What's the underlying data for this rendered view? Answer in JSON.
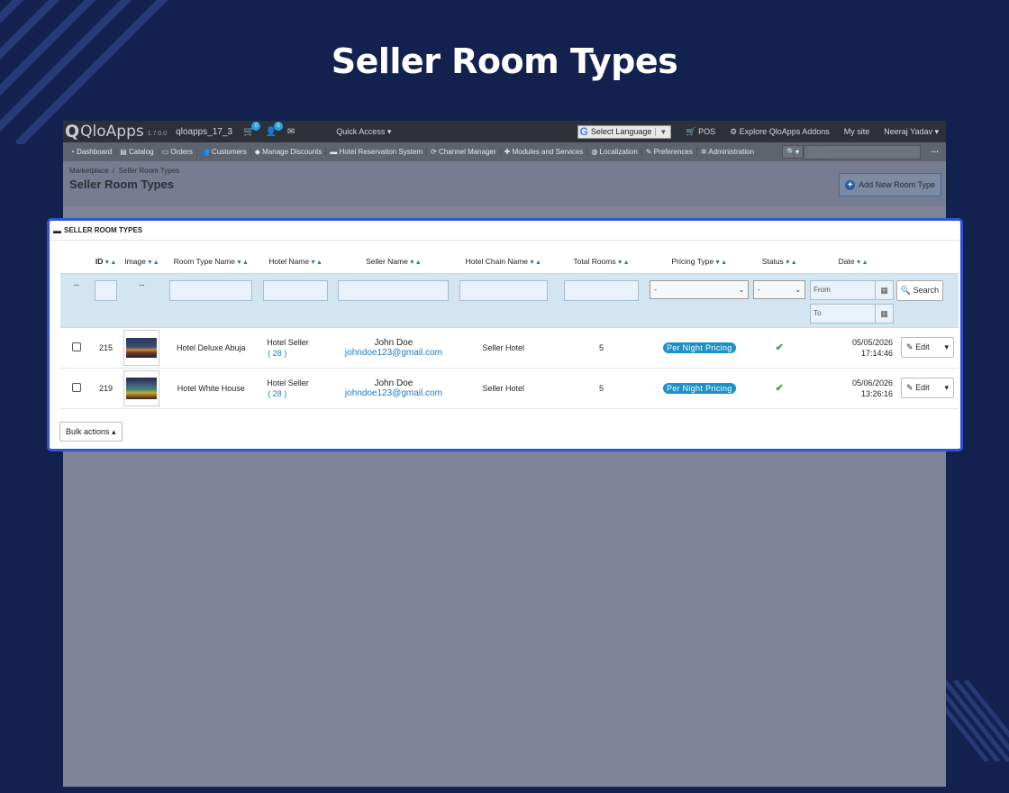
{
  "hero": {
    "title": "Seller Room Types"
  },
  "topbar": {
    "logo": "QloApps",
    "version": "1.7.0.0",
    "shop": "qloapps_17_3",
    "cart_badge": "0",
    "user_badge": "0",
    "quick_access": "Quick Access",
    "language": "Select Language",
    "pos": "POS",
    "explore": "Explore QloApps Addons",
    "mysite": "My site",
    "user": "Neeraj Yadav"
  },
  "menu": {
    "items": [
      "Dashboard",
      "Catalog",
      "Orders",
      "Customers",
      "Manage Discounts",
      "Hotel Reservation System",
      "Channel Manager",
      "Modules and Services",
      "Localization",
      "Preferences",
      "Administration"
    ],
    "search_placeholder": "Search"
  },
  "page": {
    "breadcrumb": [
      "Marketplace",
      "Seller Room Types"
    ],
    "title": "Seller Room Types",
    "add_button": "Add New Room Type"
  },
  "panel": {
    "title": "SELLER ROOM TYPES",
    "columns": [
      "ID",
      "Image",
      "Room Type Name",
      "Hotel Name",
      "Seller Name",
      "Hotel Chain Name",
      "Total Rooms",
      "Pricing Type",
      "Status",
      "Date"
    ],
    "filter": {
      "id_dash": "--",
      "image_dash": "--",
      "pricing_select": "-",
      "status_select": "-",
      "from_placeholder": "From",
      "to_placeholder": "To",
      "search_button": "Search"
    },
    "rows": [
      {
        "id": "215",
        "room_type": "Hotel Deluxe Abuja",
        "hotel": "Hotel Seller",
        "hotel_count": "( 28 )",
        "seller_name": "John Doe",
        "seller_email": "johndoe123@gmail.com",
        "chain": "Seller Hotel",
        "rooms": "5",
        "pricing": "Per Night Pricing",
        "date": "05/05/2026",
        "time": "17:14:46",
        "edit": "Edit"
      },
      {
        "id": "219",
        "room_type": "Hotel White House",
        "hotel": "Hotel Seller",
        "hotel_count": "( 28 )",
        "seller_name": "John Doe",
        "seller_email": "johndoe123@gmail.com",
        "chain": "Seller Hotel",
        "rooms": "5",
        "pricing": "Per Night Pricing",
        "date": "05/06/2026",
        "time": "13:26:16",
        "edit": "Edit"
      }
    ],
    "bulk_actions": "Bulk actions"
  },
  "colors": {
    "background": "#13214f",
    "panel_border": "#2f54d6",
    "accent": "#1d7ac8"
  }
}
